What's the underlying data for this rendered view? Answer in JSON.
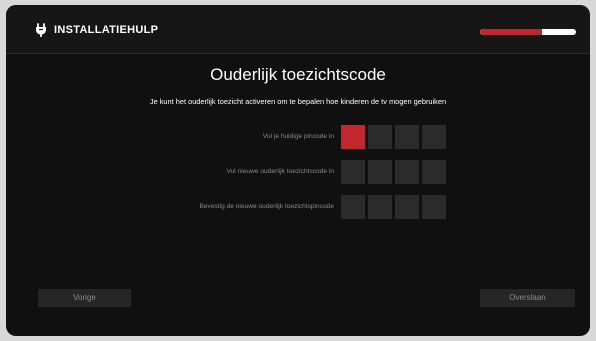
{
  "header": {
    "title": "INSTALLATIEHULP",
    "logo_icon": "power-plug-icon",
    "progress": 0.65,
    "progress_color": "#c1272d",
    "progress_track_color": "#ffffff"
  },
  "main": {
    "title": "Ouderlijk toezichtscode",
    "subtitle": "Je kunt het ouderlijk toezicht activeren om te bepalen hoe kinderen de tv mogen gebruiken",
    "fields": [
      {
        "label": "Vul je huidige pincode in",
        "digits": 4,
        "active_digit": 0
      },
      {
        "label": "Vul nieuwe ouderlijk toezichtscode in",
        "digits": 4
      },
      {
        "label": "Bevestig de nieuwe ouderlijk toezichtspincode",
        "digits": 4
      }
    ],
    "accent_color": "#c1272d"
  },
  "footer": {
    "prev_label": "Vorige",
    "skip_label": "Overslaan"
  }
}
